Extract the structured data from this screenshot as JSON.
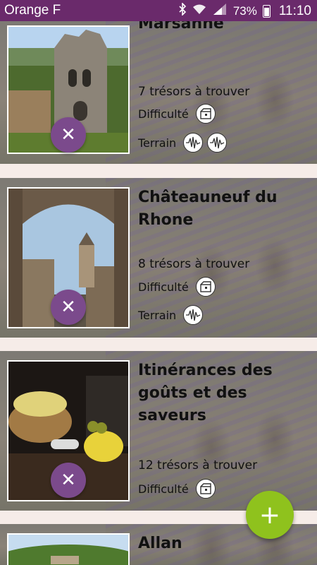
{
  "status_bar": {
    "carrier": "Orange F",
    "battery": "73%",
    "time": "11:10",
    "icons": [
      "bluetooth-icon",
      "wifi-icon",
      "signal-icon",
      "battery-icon"
    ]
  },
  "colors": {
    "status_bar": "#6a2a6b",
    "remove_button": "#7b4a8c",
    "add_button": "#8fc21d",
    "separator": "#f6ece8"
  },
  "cards": [
    {
      "title": "Marsanne",
      "treasures": "7 trésors à trouver",
      "difficulty_label": "Difficulté",
      "terrain_label": "Terrain",
      "difficulty_icons": 1,
      "terrain_icons": 2
    },
    {
      "title": "Châteauneuf du Rhone",
      "treasures": "8 trésors à trouver",
      "difficulty_label": "Difficulté",
      "terrain_label": "Terrain",
      "difficulty_icons": 1,
      "terrain_icons": 1
    },
    {
      "title": "Itinérances des goûts et des saveurs",
      "treasures": "12 trésors à trouver",
      "difficulty_label": "Difficulté",
      "difficulty_icons": 1
    },
    {
      "title": "Allan"
    }
  ],
  "remove_label": "✕",
  "add_label": "+"
}
